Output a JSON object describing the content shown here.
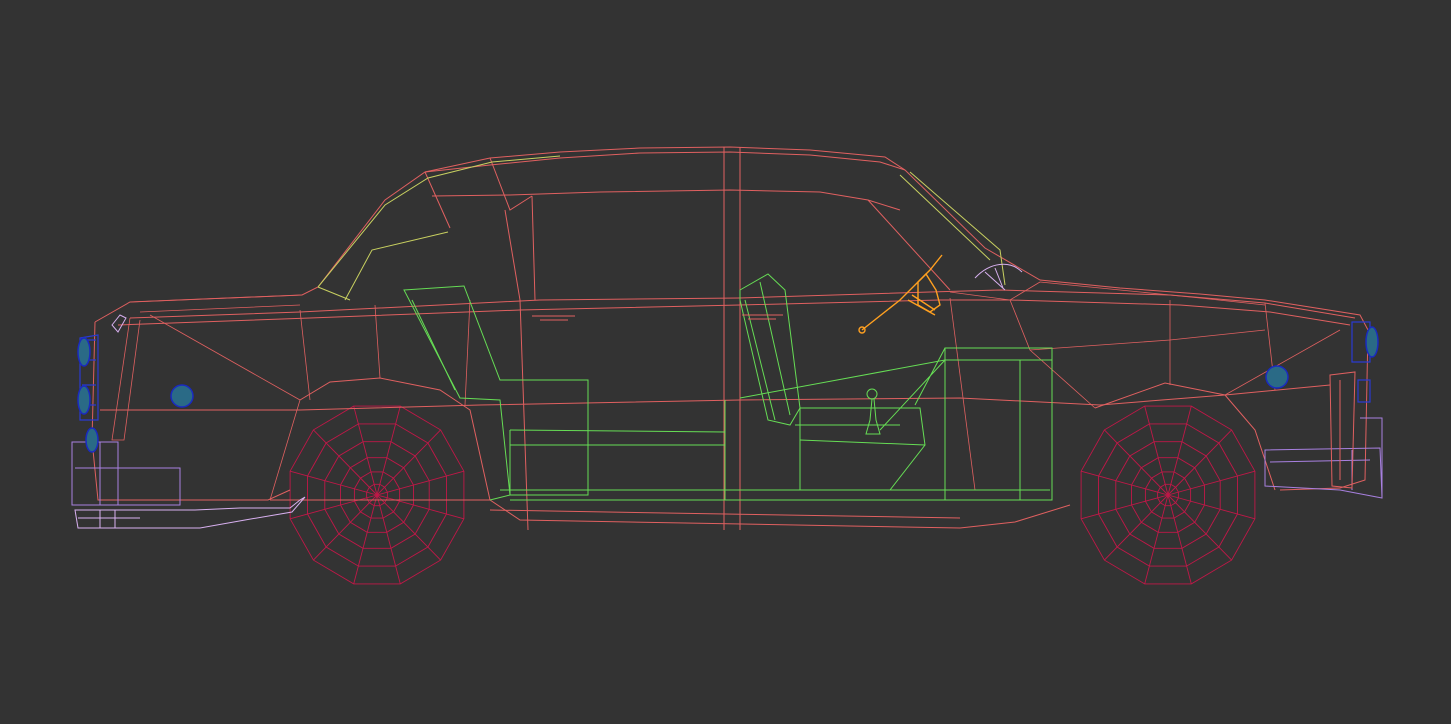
{
  "viewport": {
    "background": "#333333",
    "subject": "sedan-wireframe",
    "view": "side"
  },
  "colors": {
    "body": "#e06060",
    "interior": "#66dd55",
    "glass_trim": "#c8d060",
    "wheels": "#c01848",
    "bumpers": "#a880e0",
    "steering": "#ffa020",
    "lamps": "#2a3ad0"
  },
  "icons": {
    "steering_wheel": "steering-wheel-icon",
    "gear_lever": "gear-lever-icon",
    "wiper": "wiper-icon",
    "lamp": "lamp-icon"
  }
}
